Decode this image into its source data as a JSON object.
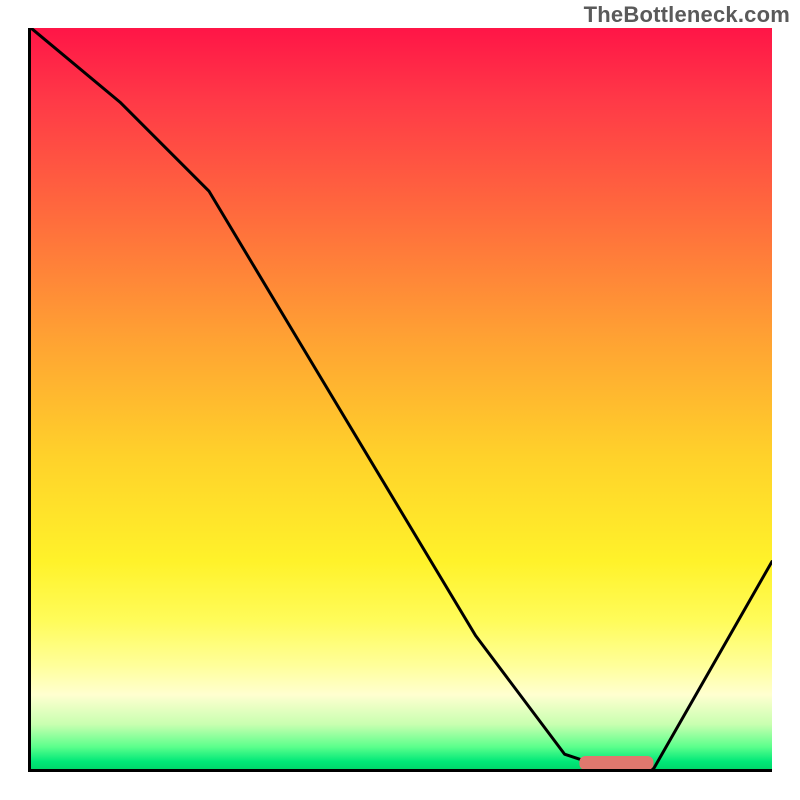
{
  "watermark": "TheBottleneck.com",
  "chart_data": {
    "type": "line",
    "title": "",
    "xlabel": "",
    "ylabel": "",
    "xlim": [
      0,
      100
    ],
    "ylim": [
      0,
      100
    ],
    "grid": false,
    "colors": {
      "gradient_top": "#ff1547",
      "gradient_mid": "#ffd22a",
      "gradient_bottom": "#00d86b",
      "curve": "#000000",
      "marker": "#e0786e"
    },
    "series": [
      {
        "name": "bottleneck-curve",
        "x": [
          0,
          12,
          24,
          36,
          48,
          60,
          72,
          78,
          84,
          100
        ],
        "y": [
          100,
          90,
          78,
          58,
          38,
          18,
          2,
          0,
          0,
          28
        ]
      }
    ],
    "marker": {
      "name": "optimal-range",
      "x_start": 74,
      "x_end": 84,
      "y": 0.8
    }
  }
}
